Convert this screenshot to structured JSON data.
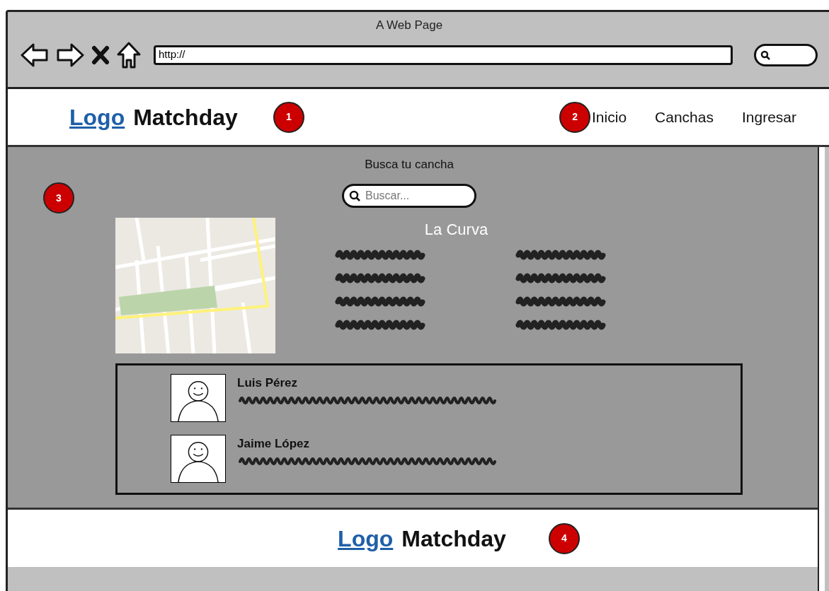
{
  "window": {
    "title": "A Web Page",
    "address": "http://"
  },
  "header": {
    "logo_link": "Logo",
    "brand": "Matchday",
    "badge": "1",
    "nav_badge": "2",
    "nav": [
      {
        "label": "Inicio"
      },
      {
        "label": "Canchas"
      },
      {
        "label": "Ingresar"
      }
    ]
  },
  "content": {
    "heading": "Busca tu cancha",
    "badge": "3",
    "search": {
      "placeholder": "Buscar..."
    },
    "venue": {
      "name": "La Curva"
    },
    "people": [
      {
        "name": "Luis Pérez"
      },
      {
        "name": "Jaime López"
      }
    ]
  },
  "footer": {
    "logo_link": "Logo",
    "brand": "Matchday",
    "badge": "4"
  }
}
